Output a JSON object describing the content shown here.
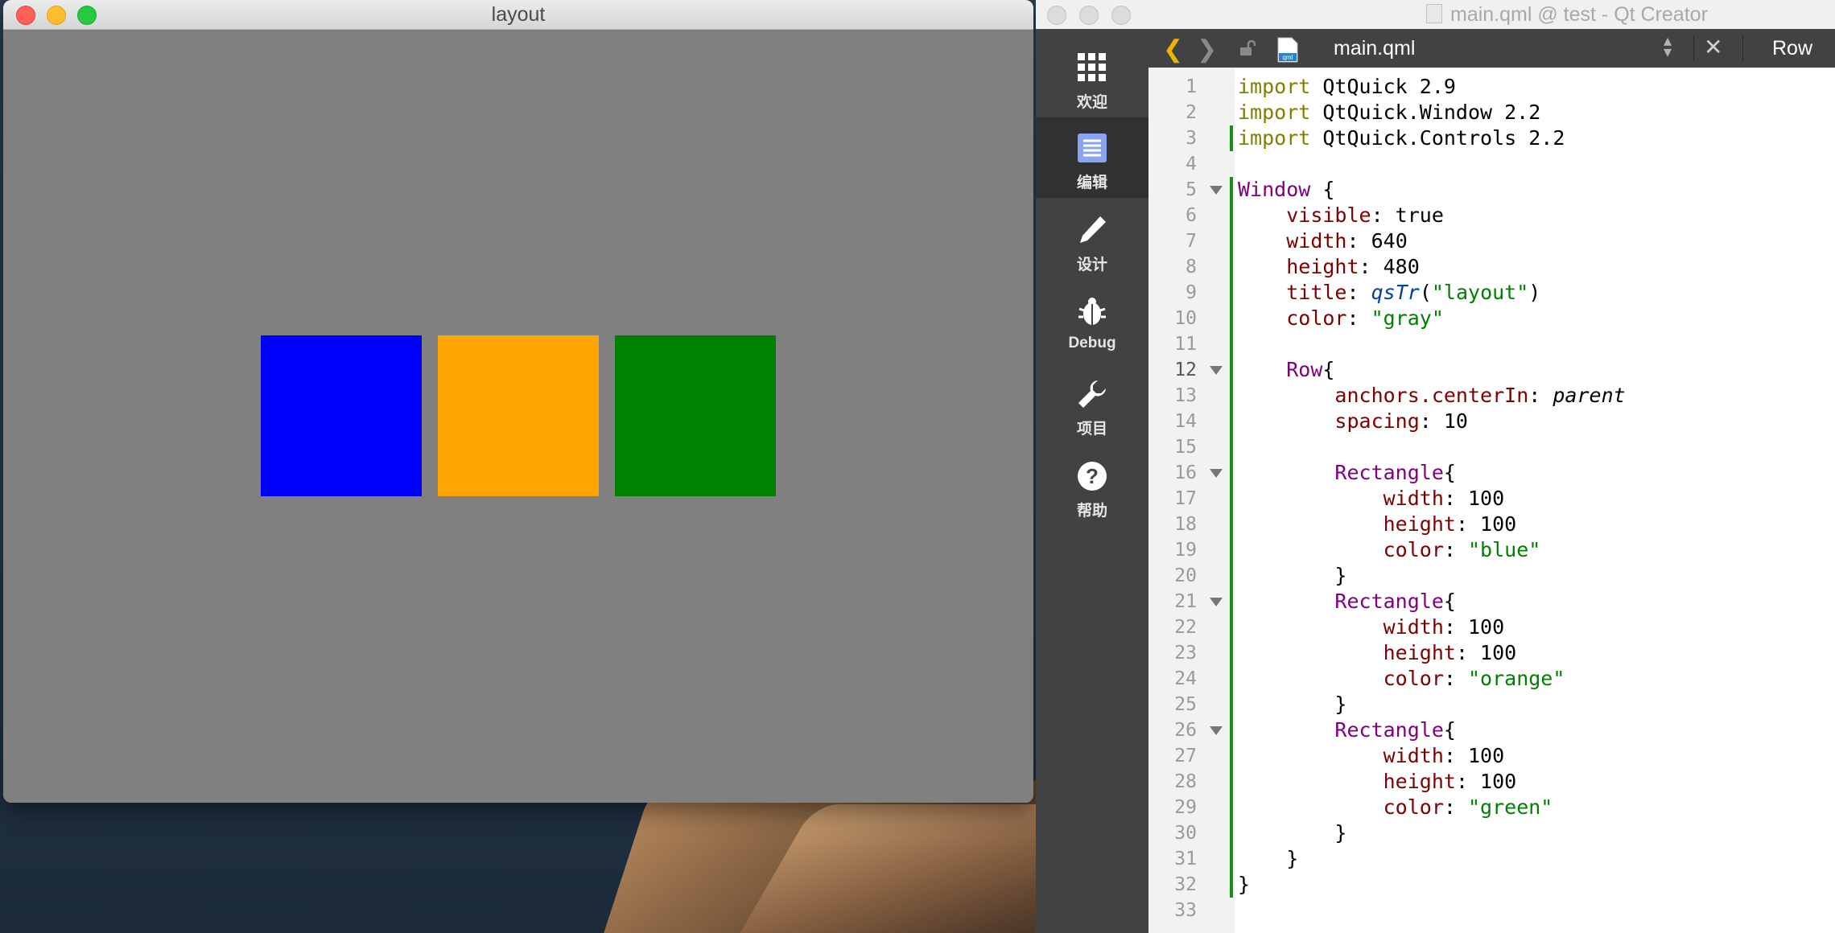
{
  "app_window": {
    "title": "layout",
    "background": "#808080",
    "rectangles": [
      {
        "name": "blue",
        "color": "#0000ff"
      },
      {
        "name": "orange",
        "color": "#ffa500"
      },
      {
        "name": "green",
        "color": "#008000"
      }
    ]
  },
  "qt_window": {
    "title": "main.qml @ test - Qt Creator",
    "modes": [
      {
        "label": "欢迎",
        "icon": "grid-icon"
      },
      {
        "label": "编辑",
        "icon": "edit-doc-icon"
      },
      {
        "label": "设计",
        "icon": "pencil-icon"
      },
      {
        "label": "Debug",
        "icon": "bug-icon"
      },
      {
        "label": "项目",
        "icon": "wrench-icon"
      },
      {
        "label": "帮助",
        "icon": "help-icon"
      }
    ],
    "toolbar": {
      "filename": "main.qml",
      "symbol": "Row"
    },
    "editor": {
      "current_line": 12,
      "lines": [
        "import QtQuick 2.9",
        "import QtQuick.Window 2.2",
        "import QtQuick.Controls 2.2",
        "",
        "Window {",
        "    visible: true",
        "    width: 640",
        "    height: 480",
        "    title: qsTr(\"layout\")",
        "    color: \"gray\"",
        "",
        "    Row{",
        "        anchors.centerIn: parent",
        "        spacing: 10",
        "",
        "        Rectangle{",
        "            width: 100",
        "            height: 100",
        "            color: \"blue\"",
        "        }",
        "        Rectangle{",
        "            width: 100",
        "            height: 100",
        "            color: \"orange\"",
        "        }",
        "        Rectangle{",
        "            width: 100",
        "            height: 100",
        "            color: \"green\"",
        "        }",
        "    }",
        "}",
        ""
      ],
      "fold_lines": [
        5,
        12,
        16,
        21,
        26
      ]
    },
    "colors": {
      "sidebar": "#404244",
      "accent_back": "#f0b400",
      "change_bar": "#1a8c1a"
    }
  }
}
